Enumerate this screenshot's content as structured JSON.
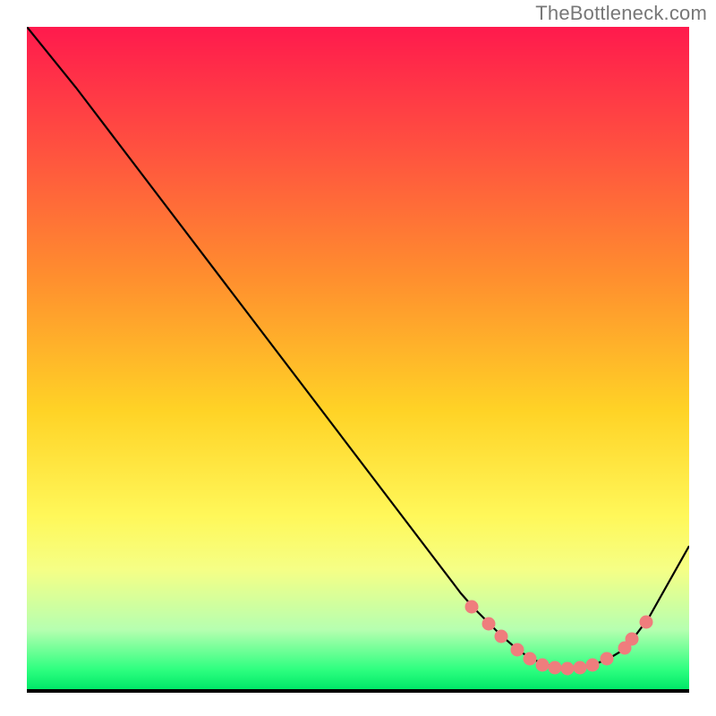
{
  "watermark": "TheBottleneck.com",
  "chart_data": {
    "type": "line",
    "title": "",
    "xlabel": "",
    "ylabel": "",
    "xlim": [
      0,
      100
    ],
    "ylim": [
      0,
      100
    ],
    "background": "vertical-gradient red→orange→yellow→green (red=high bottleneck, green=low)",
    "series": [
      {
        "name": "bottleneck-curve",
        "x": [
          0,
          7,
          66,
          70,
          74,
          78,
          82,
          86,
          90,
          93,
          100
        ],
        "y": [
          100,
          91,
          15,
          11,
          7,
          4,
          3,
          4,
          8,
          12,
          22
        ],
        "note": "y is % height from bottom; curve descends steeply then bottoms out near x≈82 then rises"
      }
    ],
    "markers": {
      "name": "optimal-range-dots",
      "color": "#ef7d7d",
      "x": [
        67,
        70,
        72,
        74,
        76,
        78,
        80,
        82,
        84,
        86,
        88,
        90,
        91,
        93
      ],
      "y": [
        12,
        10,
        8,
        6,
        5,
        4,
        3.5,
        3,
        3.2,
        4,
        5,
        6,
        7.5,
        10
      ]
    },
    "annotations": [
      {
        "type": "watermark",
        "text": "TheBottleneck.com",
        "position": "top-right"
      }
    ]
  }
}
